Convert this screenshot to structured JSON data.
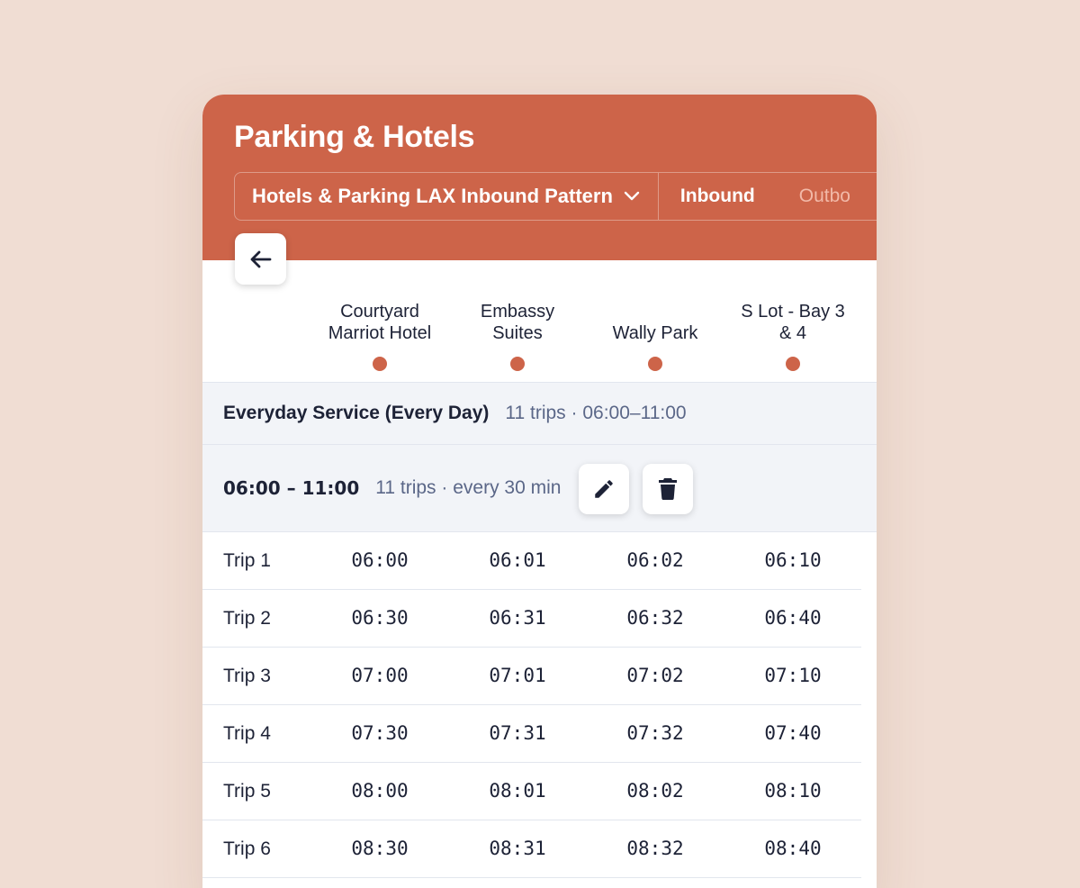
{
  "header": {
    "title": "Parking & Hotels",
    "pattern_label": "Hotels & Parking LAX Inbound Pattern",
    "tabs": [
      {
        "label": "Inbound",
        "active": true
      },
      {
        "label": "Outbo",
        "active": false
      }
    ],
    "accent_color": "#cd6449"
  },
  "back_icon": "arrow-left-icon",
  "stops": [
    {
      "line1": "Courtyard",
      "line2": "Marriot Hotel"
    },
    {
      "line1": "Embassy",
      "line2": "Suites"
    },
    {
      "line1": "",
      "line2": "Wally Park"
    },
    {
      "line1": "S Lot - Bay 3",
      "line2": "& 4"
    }
  ],
  "service": {
    "name": "Everyday Service (Every Day)",
    "meta": "11 trips · 06:00–11:00"
  },
  "window": {
    "range": "06:00 – 11:00",
    "meta": "11 trips · every 30 min",
    "edit_icon": "pencil-icon",
    "delete_icon": "trash-icon"
  },
  "trips": [
    {
      "label": "Trip 1",
      "times": [
        "06:00",
        "06:01",
        "06:02",
        "06:10"
      ]
    },
    {
      "label": "Trip 2",
      "times": [
        "06:30",
        "06:31",
        "06:32",
        "06:40"
      ]
    },
    {
      "label": "Trip 3",
      "times": [
        "07:00",
        "07:01",
        "07:02",
        "07:10"
      ]
    },
    {
      "label": "Trip 4",
      "times": [
        "07:30",
        "07:31",
        "07:32",
        "07:40"
      ]
    },
    {
      "label": "Trip 5",
      "times": [
        "08:00",
        "08:01",
        "08:02",
        "08:10"
      ]
    },
    {
      "label": "Trip 6",
      "times": [
        "08:30",
        "08:31",
        "08:32",
        "08:40"
      ]
    }
  ]
}
